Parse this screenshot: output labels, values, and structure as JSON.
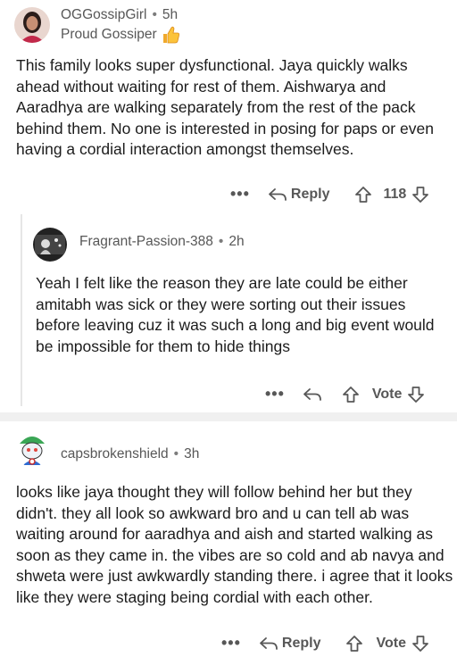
{
  "comments": [
    {
      "username": "OGGossipGirl",
      "separator": "•",
      "age": "5h",
      "flair": "Proud Gossiper",
      "flair_icon": "thumbs-up-emoji",
      "text": "This family looks super dysfunctional. Jaya quickly walks ahead without waiting for rest of them. Aishwarya and Aaradhya are walking separately from the rest of the pack behind them. No one is interested in posing for paps or even having a cordial interaction amongst themselves.",
      "more": "•••",
      "reply_label": "Reply",
      "vote_count": "118"
    },
    {
      "username": "Fragrant-Passion-388",
      "separator": "•",
      "age": "2h",
      "text": "Yeah I felt like the reason they are late could be either amitabh was sick or they were sorting out their issues before leaving cuz it was such a long and big event would be impossible for them to hide things",
      "more": "•••",
      "vote_label": "Vote"
    },
    {
      "username": "capsbrokenshield",
      "separator": "•",
      "age": "3h",
      "text": "looks like jaya thought they will follow behind her but they didn't. they all look so awkward bro and u can tell ab was waiting around for aaradhya and aish and started walking as soon as they came in. the vibes are so cold and ab navya and shweta were just awkwardly standing there. i agree that it looks like they were staging being cordial with each other.",
      "more": "•••",
      "reply_label": "Reply",
      "vote_label": "Vote"
    }
  ],
  "colors": {
    "text": "#1c1c1c",
    "meta": "#575757",
    "divider": "#f0f0f0"
  }
}
